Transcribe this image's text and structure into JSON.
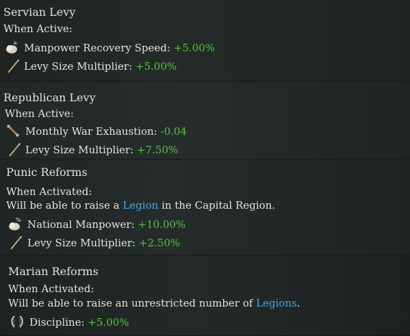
{
  "sections": [
    {
      "title": "Servian Levy",
      "condition": "When Active:",
      "modifiers": [
        {
          "icon": "manpower-sack-icon",
          "label": "Manpower Recovery Speed:",
          "value": "+5.00%"
        },
        {
          "icon": "spear-icon",
          "label": "Levy Size Multiplier:",
          "value": "+5.00%"
        }
      ]
    },
    {
      "title": "Republican Levy",
      "condition": "When Active:",
      "modifiers": [
        {
          "icon": "war-exhaustion-icon",
          "label": "Monthly War Exhaustion:",
          "value": "-0.04"
        },
        {
          "icon": "spear-icon",
          "label": "Levy Size Multiplier:",
          "value": "+7.50%"
        }
      ]
    },
    {
      "title": "Punic Reforms",
      "condition": "When Activated:",
      "note": {
        "prefix": "Will be able to raise a ",
        "link": "Legion",
        "suffix": " in the Capital Region."
      },
      "modifiers": [
        {
          "icon": "manpower-percent-icon",
          "label": "National Manpower:",
          "value": "+10.00%"
        },
        {
          "icon": "spear-icon",
          "label": "Levy Size Multiplier:",
          "value": "+2.50%"
        }
      ]
    },
    {
      "title": "Marian Reforms",
      "condition": "When Activated:",
      "note": {
        "prefix": "Will be able to raise an unrestricted number of ",
        "link": "Legions",
        "suffix": "."
      },
      "modifiers": [
        {
          "icon": "discipline-laurel-icon",
          "label": "Discipline:",
          "value": "+5.00%"
        }
      ]
    }
  ],
  "colors": {
    "positive": "#57c442",
    "link": "#41a8e6",
    "text": "#e6e3da",
    "background": "#1c2120"
  }
}
